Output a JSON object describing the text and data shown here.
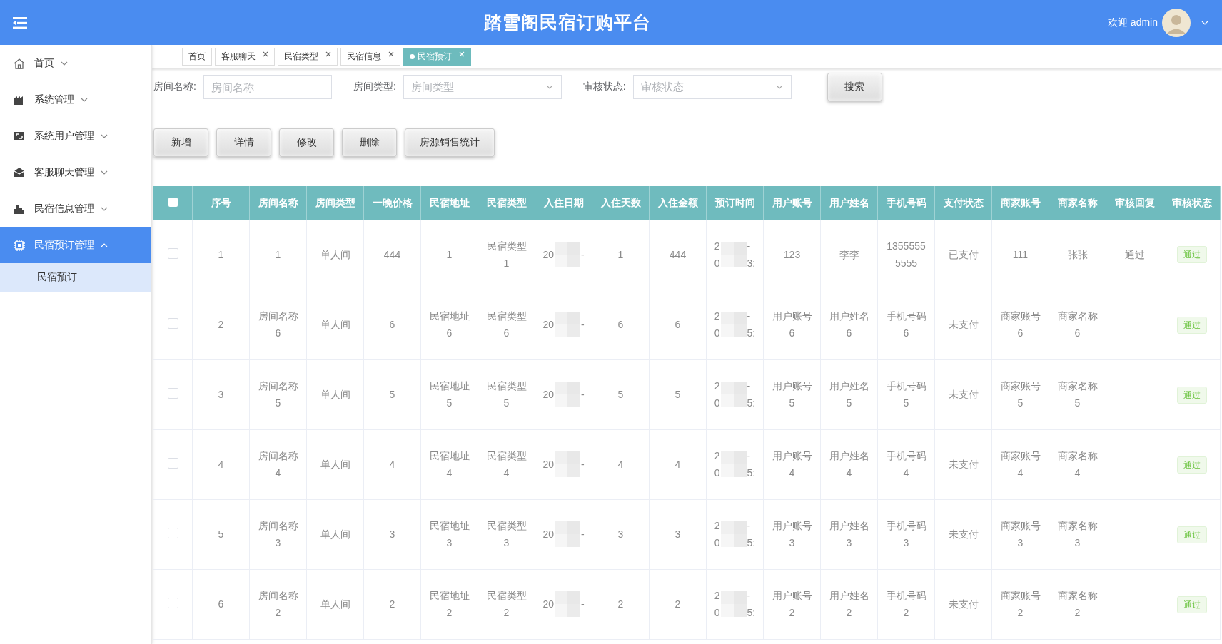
{
  "header": {
    "title": "踏雪阁民宿订购平台",
    "welcome": "欢迎 admin"
  },
  "sidebar": {
    "items": [
      {
        "label": "首页",
        "selected": false,
        "expanded": false
      },
      {
        "label": "系统管理",
        "selected": false,
        "expanded": false
      },
      {
        "label": "系统用户管理",
        "selected": false,
        "expanded": false
      },
      {
        "label": "客服聊天管理",
        "selected": false,
        "expanded": false
      },
      {
        "label": "民宿信息管理",
        "selected": false,
        "expanded": false
      },
      {
        "label": "民宿预订管理",
        "selected": true,
        "expanded": true,
        "children": [
          {
            "label": "民宿预订",
            "selected": true
          }
        ]
      }
    ]
  },
  "tabs": [
    {
      "label": "首页",
      "selected": false,
      "closable": false
    },
    {
      "label": "客服聊天",
      "selected": false,
      "closable": true
    },
    {
      "label": "民宿类型",
      "selected": false,
      "closable": true
    },
    {
      "label": "民宿信息",
      "selected": false,
      "closable": true
    },
    {
      "label": "民宿预订",
      "selected": true,
      "closable": true
    }
  ],
  "search": {
    "fields": [
      {
        "label": "房间名称:",
        "kind": "input",
        "placeholder": "房间名称"
      },
      {
        "label": "房间类型:",
        "kind": "select",
        "placeholder": "房间类型"
      },
      {
        "label": "审核状态:",
        "kind": "select",
        "placeholder": "审核状态"
      }
    ],
    "button": "搜索"
  },
  "actions": [
    "新增",
    "详情",
    "修改",
    "删除",
    "房源销售统计"
  ],
  "table": {
    "select_all_checked": false,
    "columns": [
      {
        "label": "序号",
        "kind": "text"
      },
      {
        "label": "房间名称",
        "kind": "text"
      },
      {
        "label": "房间类型",
        "kind": "text"
      },
      {
        "label": "一晚价格",
        "kind": "text"
      },
      {
        "label": "民宿地址",
        "kind": "text"
      },
      {
        "label": "民宿类型",
        "kind": "text"
      },
      {
        "label": "入住日期",
        "kind": "redacted"
      },
      {
        "label": "入住天数",
        "kind": "text"
      },
      {
        "label": "入住金额",
        "kind": "text"
      },
      {
        "label": "预订时间",
        "kind": "redacted"
      },
      {
        "label": "用户账号",
        "kind": "text"
      },
      {
        "label": "用户姓名",
        "kind": "text"
      },
      {
        "label": "手机号码",
        "kind": "text"
      },
      {
        "label": "支付状态",
        "kind": "text"
      },
      {
        "label": "商家账号",
        "kind": "text"
      },
      {
        "label": "商家名称",
        "kind": "text"
      },
      {
        "label": "审核回复",
        "kind": "text"
      },
      {
        "label": "审核状态",
        "kind": "tag"
      }
    ],
    "rows": [
      {
        "selected": false,
        "cells": [
          "1",
          "1",
          "单人间",
          "444",
          "1",
          "民宿类型1",
          [
            [
              "20",
              "-"
            ]
          ],
          "1",
          "444",
          [
            [
              "2",
              "-"
            ],
            [
              "0",
              "3:"
            ]
          ],
          "123",
          "李李",
          "13555555555",
          "已支付",
          "111",
          "张张",
          "通过",
          "通过"
        ]
      },
      {
        "selected": false,
        "cells": [
          "2",
          "房间名称6",
          "单人间",
          "6",
          "民宿地址6",
          "民宿类型6",
          [
            [
              "20",
              "-"
            ]
          ],
          "6",
          "6",
          [
            [
              "2",
              "-"
            ],
            [
              "0",
              "5:"
            ]
          ],
          "用户账号6",
          "用户姓名6",
          "手机号码6",
          "未支付",
          "商家账号6",
          "商家名称6",
          "",
          "通过"
        ]
      },
      {
        "selected": false,
        "cells": [
          "3",
          "房间名称5",
          "单人间",
          "5",
          "民宿地址5",
          "民宿类型5",
          [
            [
              "20",
              "-"
            ]
          ],
          "5",
          "5",
          [
            [
              "2",
              "-"
            ],
            [
              "0",
              "5:"
            ]
          ],
          "用户账号5",
          "用户姓名5",
          "手机号码5",
          "未支付",
          "商家账号5",
          "商家名称5",
          "",
          "通过"
        ]
      },
      {
        "selected": false,
        "cells": [
          "4",
          "房间名称4",
          "单人间",
          "4",
          "民宿地址4",
          "民宿类型4",
          [
            [
              "20",
              "-"
            ]
          ],
          "4",
          "4",
          [
            [
              "2",
              "-"
            ],
            [
              "0",
              "5:"
            ]
          ],
          "用户账号4",
          "用户姓名4",
          "手机号码4",
          "未支付",
          "商家账号4",
          "商家名称4",
          "",
          "通过"
        ]
      },
      {
        "selected": false,
        "cells": [
          "5",
          "房间名称3",
          "单人间",
          "3",
          "民宿地址3",
          "民宿类型3",
          [
            [
              "20",
              "-"
            ]
          ],
          "3",
          "3",
          [
            [
              "2",
              "-"
            ],
            [
              "0",
              "5:"
            ]
          ],
          "用户账号3",
          "用户姓名3",
          "手机号码3",
          "未支付",
          "商家账号3",
          "商家名称3",
          "",
          "通过"
        ]
      },
      {
        "selected": false,
        "cells": [
          "6",
          "房间名称2",
          "单人间",
          "2",
          "民宿地址2",
          "民宿类型2",
          [
            [
              "20",
              "-"
            ]
          ],
          "2",
          "2",
          [
            [
              "2",
              "-"
            ],
            [
              "0",
              "5:"
            ]
          ],
          "用户账号2",
          "用户姓名2",
          "手机号码2",
          "未支付",
          "商家账号2",
          "商家名称2",
          "",
          "通过"
        ]
      }
    ]
  }
}
